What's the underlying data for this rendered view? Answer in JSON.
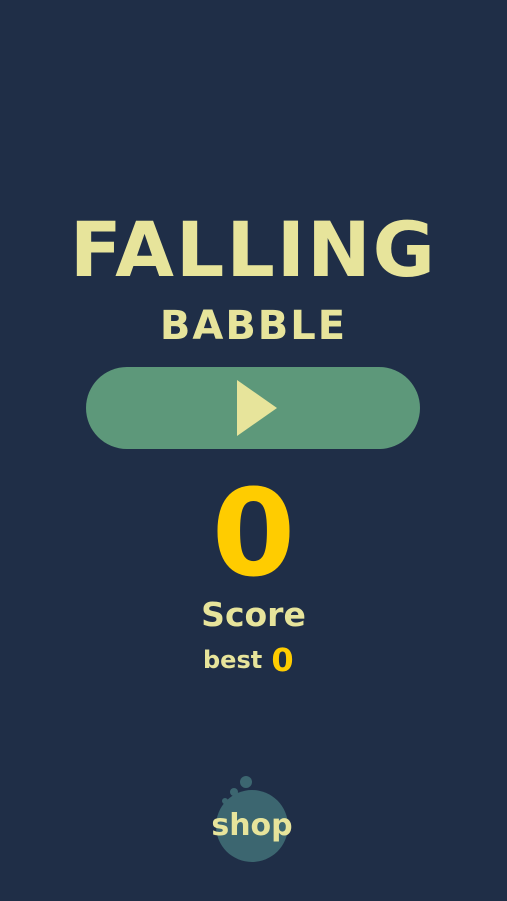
{
  "game": {
    "title_line1": "FALLING",
    "title_line2": "BABBLE"
  },
  "play_button": {
    "icon": "play-icon"
  },
  "score": {
    "value": "0",
    "label": "Score",
    "best_label": "best",
    "best_value": "0"
  },
  "shop": {
    "label": "shop"
  },
  "colors": {
    "background": "#1f2e47",
    "title": "#e7e49b",
    "play_button": "#5d987a",
    "score": "#ffcc00",
    "shop_bubble": "#3c6670"
  }
}
